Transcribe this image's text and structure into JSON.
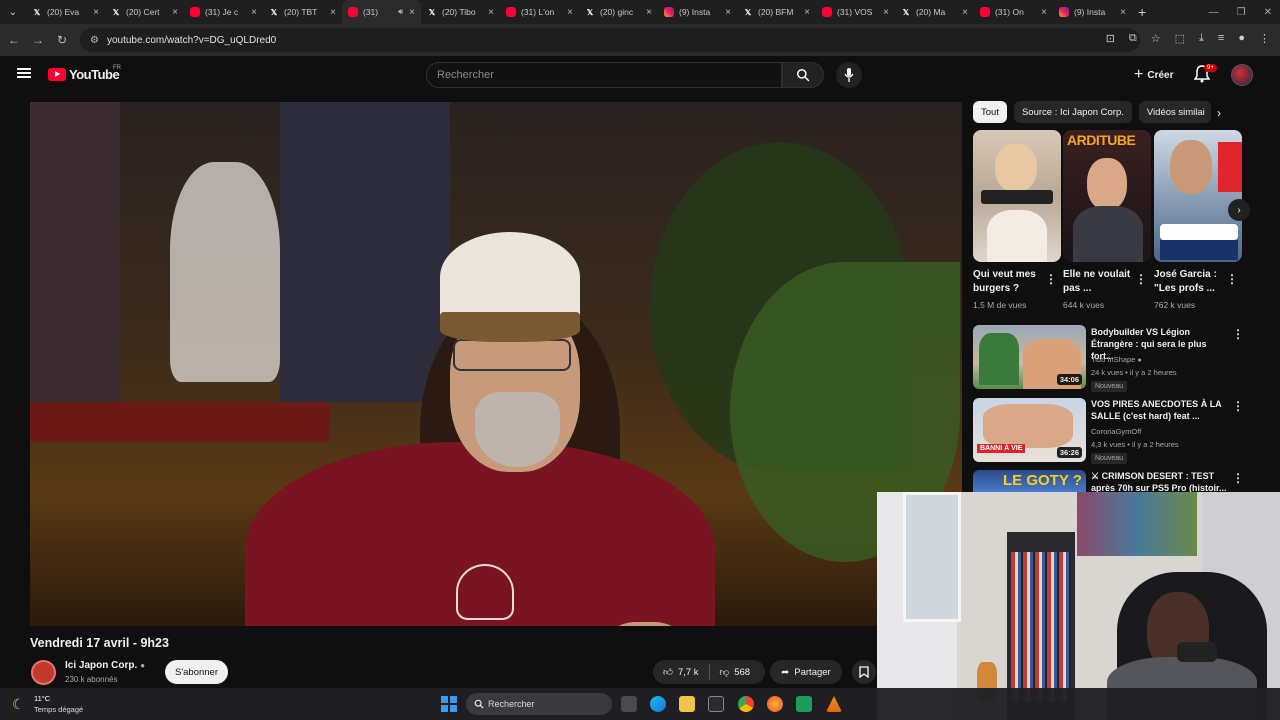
{
  "browser": {
    "tabs": [
      {
        "icon": "x-icon",
        "label": "(20) Eva"
      },
      {
        "icon": "x-icon",
        "label": "(20) Cert"
      },
      {
        "icon": "youtube-icon",
        "label": "(31) Je c"
      },
      {
        "icon": "x-icon",
        "label": "(20) TBT"
      },
      {
        "icon": "youtube-icon",
        "label": "(31) ",
        "active": true
      },
      {
        "icon": "x-icon",
        "label": "(20) Tibo"
      },
      {
        "icon": "youtube-icon",
        "label": "(31) L'on"
      },
      {
        "icon": "x-icon",
        "label": "(20) ginc"
      },
      {
        "icon": "instagram-icon",
        "label": "(9) Insta"
      },
      {
        "icon": "x-icon",
        "label": "(20) BFM"
      },
      {
        "icon": "youtube-icon",
        "label": "(31) VOS"
      },
      {
        "icon": "x-icon",
        "label": "(20) Ma"
      },
      {
        "icon": "youtube-icon",
        "label": "(31) On"
      },
      {
        "icon": "instagram-icon",
        "label": "(9) Insta"
      }
    ],
    "url": "youtube.com/watch?v=DG_uQLDred0"
  },
  "youtube": {
    "logo_text": "YouTube",
    "region": "FR",
    "search_placeholder": "Rechercher",
    "create_label": "Créer",
    "notification_count": "9+"
  },
  "video": {
    "title": "Vendredi 17 avril - 9h23",
    "channel_name": "Ici Japon Corp.",
    "subscribers": "230 k abonnés",
    "subscribe_label": "S'abonner",
    "likes": "7,7 k",
    "dislikes": "568",
    "share_label": "Partager"
  },
  "sidebar": {
    "chips": [
      "Tout",
      "Source : Ici Japon Corp.",
      "Vidéos similai"
    ],
    "shorts": [
      {
        "title": "Qui veut mes burgers ?",
        "views": "1,5 M de vues"
      },
      {
        "title": "Elle ne voulait pas ...",
        "views": "644 k vues"
      },
      {
        "title": "José Garcia : \"Les profs ...",
        "views": "762 k vues"
      }
    ],
    "recommendations": [
      {
        "title": "Bodybuilder VS Légion Étrangère : qui sera le plus fort...",
        "channel": "Tibo InShape",
        "meta": "24 k vues • il y a 2 heures",
        "duration": "34:06",
        "badge": "Nouveau"
      },
      {
        "title": "VOS PIRES ANECDOTES À LA SALLE (c'est hard) feat ...",
        "channel": "CoronaGymOff",
        "meta": "4,3 k vues • il y a 2 heures",
        "duration": "36:26",
        "badge": "Nouveau"
      },
      {
        "title": "⚔ CRIMSON DESERT : TEST après 70h sur PS5 Pro (histoir...",
        "channel": "",
        "meta": "",
        "duration": "",
        "badge": ""
      }
    ]
  },
  "taskbar": {
    "temperature": "11°C",
    "weather": "Temps dégagé",
    "search_label": "Rechercher"
  }
}
